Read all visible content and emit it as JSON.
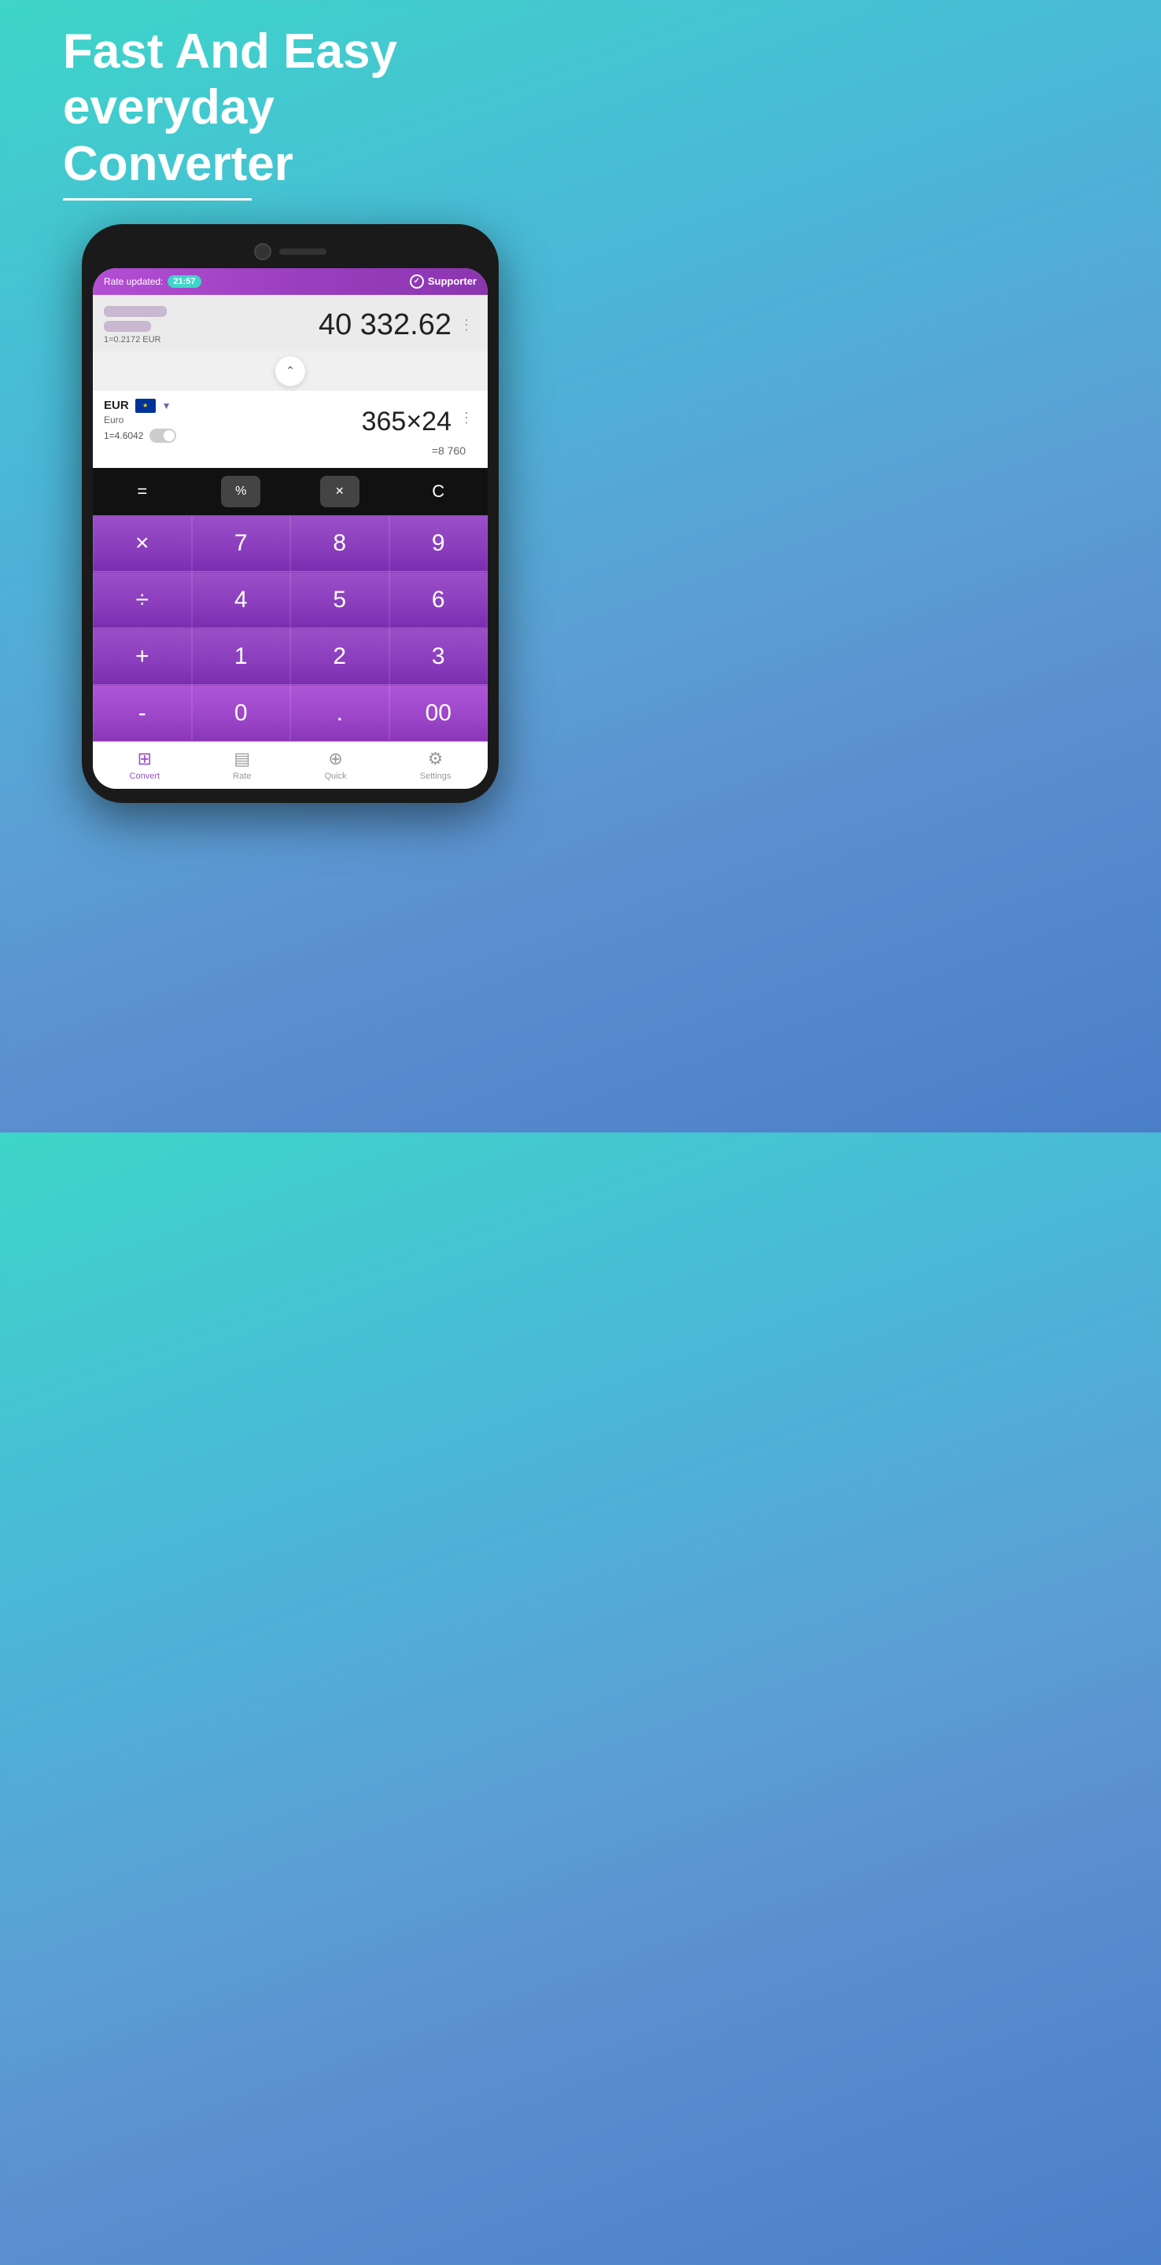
{
  "hero": {
    "line1": "Fast And Easy",
    "line2": "everyday",
    "line3": "Converter"
  },
  "phone": {
    "status_bar": {
      "rate_label": "Rate updated:",
      "time": "21:57",
      "supporter_label": "Supporter"
    },
    "top_currency": {
      "amount": "40 332.62",
      "exchange_rate": "1=0.2172 EUR"
    },
    "bottom_currency": {
      "code": "EUR",
      "name": "Euro",
      "rate": "1=4.6042",
      "formula": "365×24",
      "result": "=8 760"
    },
    "keypad": {
      "equals": "=",
      "percent": "%",
      "backspace": "⌫",
      "clear": "C",
      "buttons": [
        "×",
        "7",
        "8",
        "9",
        "÷",
        "4",
        "5",
        "6",
        "+",
        "1",
        "2",
        "3",
        "-",
        "0",
        ".",
        "00"
      ]
    },
    "nav": {
      "items": [
        {
          "label": "Convert",
          "active": true
        },
        {
          "label": "Rate",
          "active": false
        },
        {
          "label": "Quick",
          "active": false
        },
        {
          "label": "Settings",
          "active": false
        }
      ]
    }
  },
  "colors": {
    "purple_primary": "#9b4fc8",
    "teal_accent": "#3dd6c8",
    "bg_gradient_top": "#3dd6c8",
    "bg_gradient_bottom": "#4a7fc8"
  }
}
